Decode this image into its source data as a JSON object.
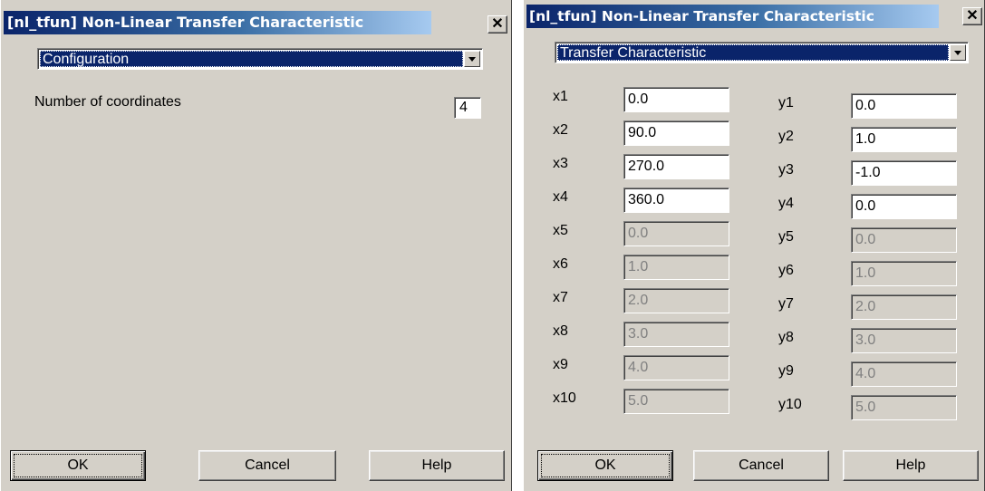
{
  "left_dialog": {
    "title": "[nl_tfun] Non-Linear Transfer Characteristic",
    "close_glyph": "✕",
    "page_select": "Configuration",
    "num_coords_label": "Number of coordinates",
    "num_coords_value": "4",
    "buttons": {
      "ok": "OK",
      "cancel": "Cancel",
      "help": "Help"
    }
  },
  "right_dialog": {
    "title": "[nl_tfun] Non-Linear Transfer Characteristic",
    "close_glyph": "✕",
    "page_select": "Transfer Characteristic",
    "rows": [
      {
        "xlabel": "x1",
        "x": "0.0",
        "ylabel": "y1",
        "y": "0.0",
        "enabled": true
      },
      {
        "xlabel": "x2",
        "x": "90.0",
        "ylabel": "y2",
        "y": "1.0",
        "enabled": true
      },
      {
        "xlabel": "x3",
        "x": "270.0",
        "ylabel": "y3",
        "y": "-1.0",
        "enabled": true
      },
      {
        "xlabel": "x4",
        "x": "360.0",
        "ylabel": "y4",
        "y": "0.0",
        "enabled": true
      },
      {
        "xlabel": "x5",
        "x": "0.0",
        "ylabel": "y5",
        "y": "0.0",
        "enabled": false
      },
      {
        "xlabel": "x6",
        "x": "1.0",
        "ylabel": "y6",
        "y": "1.0",
        "enabled": false
      },
      {
        "xlabel": "x7",
        "x": "2.0",
        "ylabel": "y7",
        "y": "2.0",
        "enabled": false
      },
      {
        "xlabel": "x8",
        "x": "3.0",
        "ylabel": "y8",
        "y": "3.0",
        "enabled": false
      },
      {
        "xlabel": "x9",
        "x": "4.0",
        "ylabel": "y9",
        "y": "4.0",
        "enabled": false
      },
      {
        "xlabel": "x10",
        "x": "5.0",
        "ylabel": "y10",
        "y": "5.0",
        "enabled": false
      }
    ],
    "buttons": {
      "ok": "OK",
      "cancel": "Cancel",
      "help": "Help"
    }
  },
  "colors": {
    "dialog_bg": "#d4d0c8",
    "title_active": "#0a246a",
    "selection": "#0a246a",
    "disabled_text": "#808080"
  }
}
